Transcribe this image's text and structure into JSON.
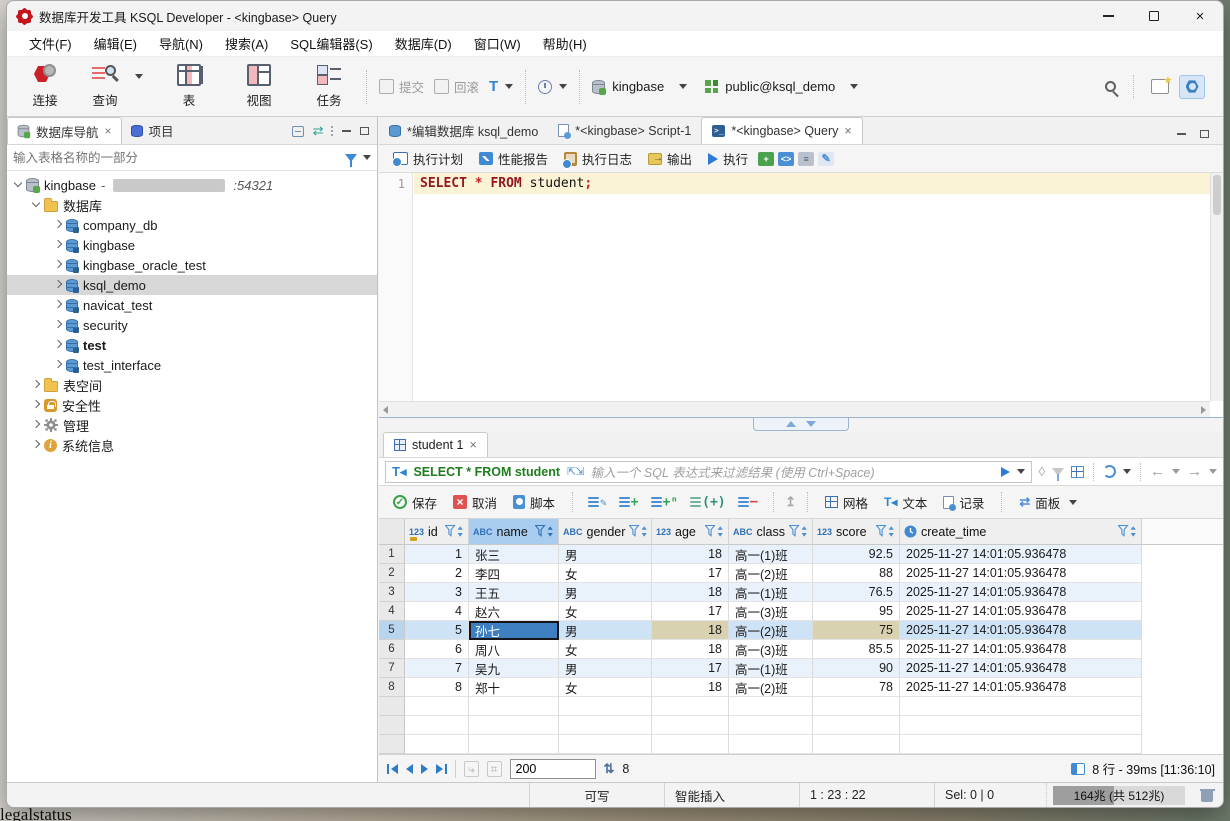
{
  "window": {
    "title": "数据库开发工具 KSQL Developer - <kingbase> Query"
  },
  "menu": [
    "文件(F)",
    "编辑(E)",
    "导航(N)",
    "搜索(A)",
    "SQL编辑器(S)",
    "数据库(D)",
    "窗口(W)",
    "帮助(H)"
  ],
  "toolbar": {
    "connect": "连接",
    "query": "查询",
    "table": "表",
    "view": "视图",
    "task": "任务",
    "commit": "提交",
    "rollback": "回滚",
    "connection": "kingbase",
    "schema": "public@ksql_demo"
  },
  "icons": {
    "app": "red-gear-logo",
    "search": "magnifier",
    "filter": "funnel",
    "run": "blue-play-triangle",
    "database": "cylinder",
    "clock": "clock-circle"
  },
  "colors": {
    "accent_blue": "#3d7fc1",
    "row_alt_blue": "#e9f1fb",
    "selected_cell": "#3d7fc1",
    "selected_row": "#cfe3f7",
    "tan_cell": "#d8d2b0",
    "header_selected": "#a9cdf0",
    "sql_keyword": "#93171c",
    "filter_green": "#1e7d1e"
  },
  "navigator": {
    "tab_database": "数据库导航",
    "tab_project": "项目",
    "search_placeholder": "输入表格名称的一部分",
    "connection": {
      "name": "kingbase",
      "dash": "-",
      "port": ":54321"
    },
    "folder_databases": "数据库",
    "databases": [
      "company_db",
      "kingbase",
      "kingbase_oracle_test",
      "ksql_demo",
      "navicat_test",
      "security",
      "test",
      "test_interface"
    ],
    "nodes": [
      "表空间",
      "安全性",
      "管理",
      "系统信息"
    ]
  },
  "editor": {
    "tabs": [
      "*编辑数据库 ksql_demo",
      "*<kingbase> Script-1",
      "*<kingbase> Query"
    ],
    "buttons": {
      "plan": "执行计划",
      "report": "性能报告",
      "log": "执行日志",
      "output": "输出",
      "run": "执行"
    },
    "line_number": "1",
    "sql": {
      "select": "SELECT",
      "star": " * ",
      "from": "FROM",
      "table": " student",
      "semicolon": ";"
    }
  },
  "results": {
    "tab": "student 1",
    "filter_expression": "SELECT * FROM student",
    "filter_placeholder": "输入一个 SQL 表达式来过滤结果 (使用 Ctrl+Space)",
    "buttons": {
      "save": "保存",
      "cancel": "取消",
      "script": "脚本",
      "grid": "网格",
      "text": "文本",
      "record": "记录",
      "panel": "面板"
    },
    "page_size": "200",
    "fetched": "8",
    "status": "8 行 - 39ms [11:36:10]"
  },
  "grid": {
    "columns": [
      {
        "type": "123",
        "label": "id"
      },
      {
        "type": "ABC",
        "label": "name"
      },
      {
        "type": "ABC",
        "label": "gender"
      },
      {
        "type": "123",
        "label": "age"
      },
      {
        "type": "ABC",
        "label": "class"
      },
      {
        "type": "123",
        "label": "score"
      },
      {
        "type": "clock",
        "label": "create_time"
      }
    ],
    "rows": [
      {
        "n": "1",
        "cells": [
          "1",
          "张三",
          "男",
          "18",
          "高一(1)班",
          "92.5",
          "2025-11-27 14:01:05.936478"
        ]
      },
      {
        "n": "2",
        "cells": [
          "2",
          "李四",
          "女",
          "17",
          "高一(2)班",
          "88",
          "2025-11-27 14:01:05.936478"
        ]
      },
      {
        "n": "3",
        "cells": [
          "3",
          "王五",
          "男",
          "18",
          "高一(1)班",
          "76.5",
          "2025-11-27 14:01:05.936478"
        ]
      },
      {
        "n": "4",
        "cells": [
          "4",
          "赵六",
          "女",
          "17",
          "高一(3)班",
          "95",
          "2025-11-27 14:01:05.936478"
        ]
      },
      {
        "n": "5",
        "cells": [
          "5",
          "孙七",
          "男",
          "18",
          "高一(2)班",
          "75",
          "2025-11-27 14:01:05.936478"
        ]
      },
      {
        "n": "6",
        "cells": [
          "6",
          "周八",
          "女",
          "18",
          "高一(3)班",
          "85.5",
          "2025-11-27 14:01:05.936478"
        ]
      },
      {
        "n": "7",
        "cells": [
          "7",
          "吴九",
          "男",
          "17",
          "高一(1)班",
          "90",
          "2025-11-27 14:01:05.936478"
        ]
      },
      {
        "n": "8",
        "cells": [
          "8",
          "郑十",
          "女",
          "18",
          "高一(2)班",
          "78",
          "2025-11-27 14:01:05.936478"
        ]
      }
    ]
  },
  "statusbar": {
    "writable": "可写",
    "input_mode": "智能插入",
    "caret_position": "1 : 23 : 22",
    "selection": "Sel: 0 | 0",
    "memory": "164兆  (共 512兆)"
  },
  "desktop_text": "legalstatus"
}
